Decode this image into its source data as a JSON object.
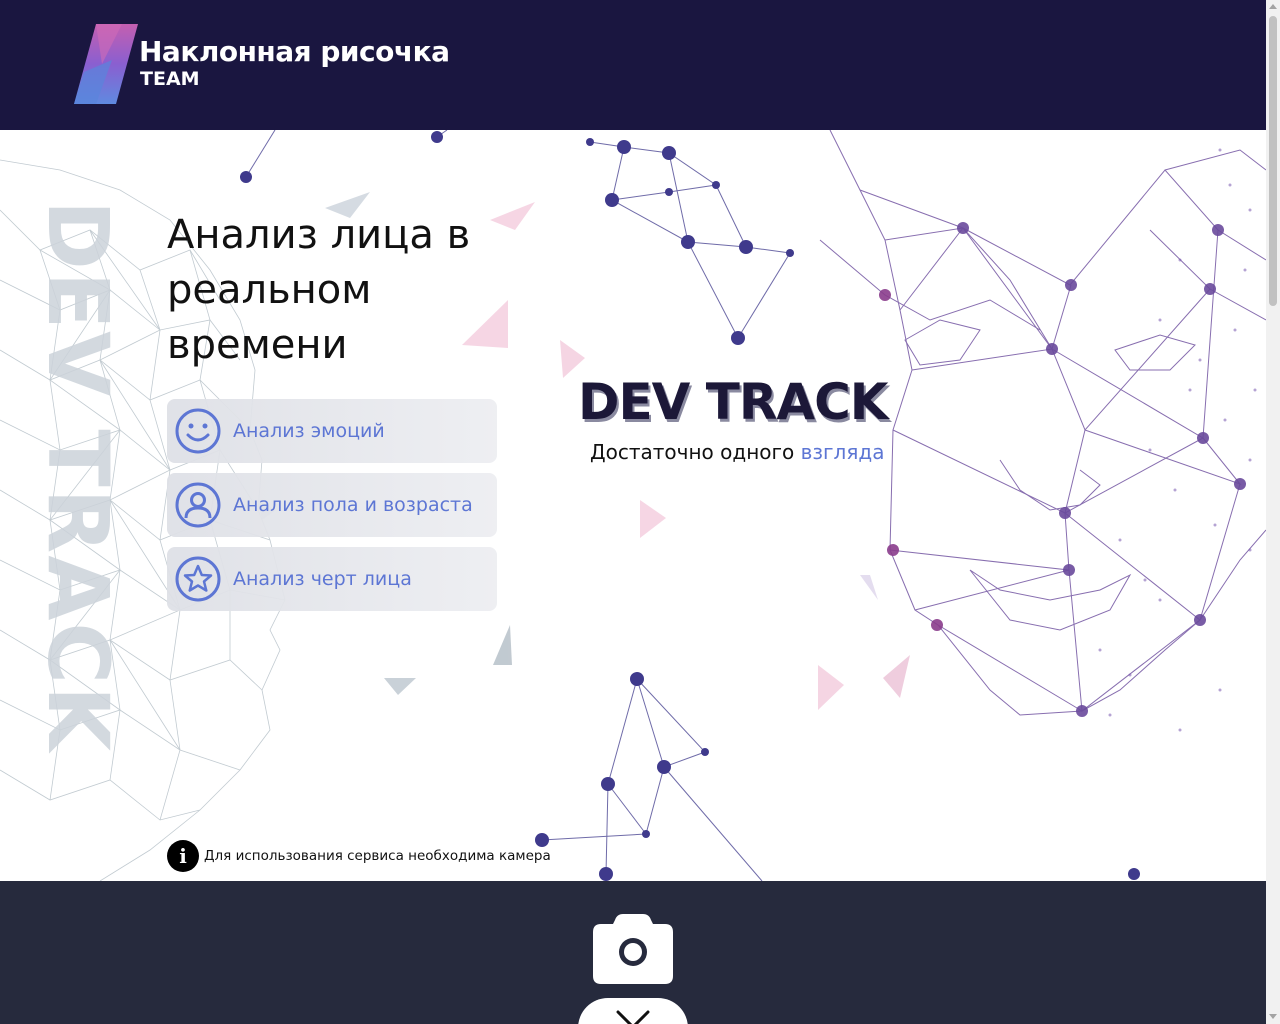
{
  "header": {
    "logo_title": "Наклонная рисочка",
    "logo_subtitle": "TEAM",
    "logo_icon": "slanted-stripe-logo-icon"
  },
  "hero": {
    "vertical_text": "DEV TRACK",
    "title": "Анализ лица в реальном времени",
    "features": [
      {
        "label": "Анализ эмоций",
        "icon": "smiley-icon"
      },
      {
        "label": "Анализ пола и возраста",
        "icon": "user-icon"
      },
      {
        "label": "Анализ черт лица",
        "icon": "star-icon"
      }
    ],
    "brand_title": "DEV TRACK",
    "brand_subtitle_prefix": "Достаточно одного",
    "brand_subtitle_accent": "взгляда",
    "notice_text": "Для использования сервиса необходима камера",
    "notice_icon": "info-icon"
  },
  "bottom": {
    "camera_icon": "camera-icon",
    "close_icon": "close-icon"
  },
  "colors": {
    "header_bg": "#1a1640",
    "accent": "#5d76d4",
    "bottom_bg": "#262a3d",
    "network_purple": "#6a4a9c"
  }
}
